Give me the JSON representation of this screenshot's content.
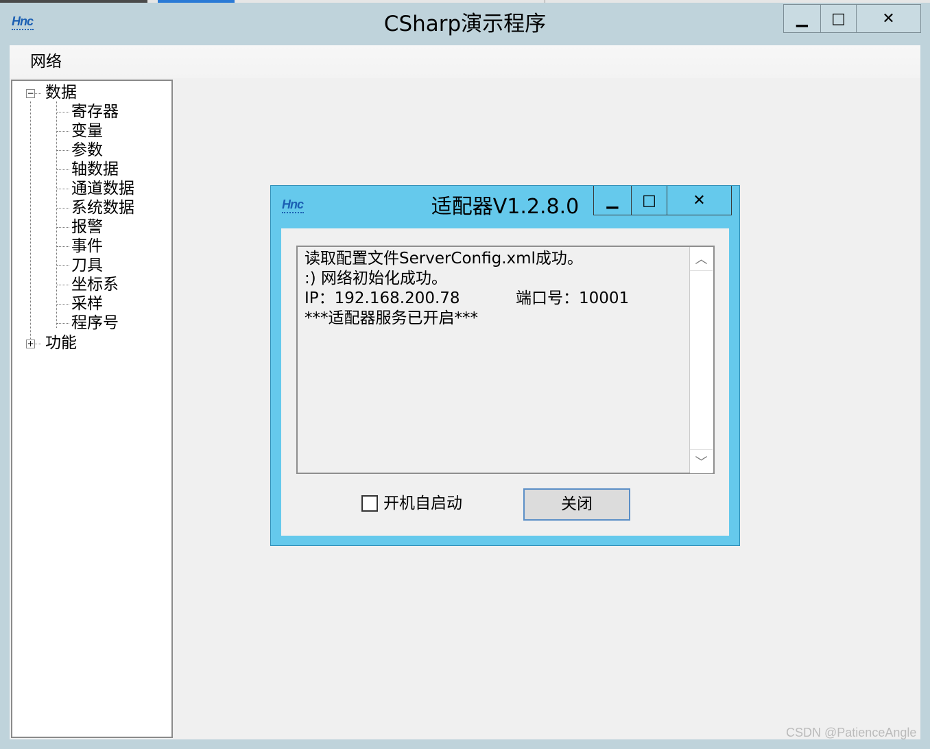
{
  "main_window": {
    "title": "CSharp演示程序",
    "buttons": {
      "minimize": "▁",
      "maximize": "□",
      "close": "✕"
    }
  },
  "menu": {
    "items": [
      "网络"
    ]
  },
  "tree": {
    "root": {
      "label": "数据",
      "expander": "−"
    },
    "children": [
      "寄存器",
      "变量",
      "参数",
      "轴数据",
      "通道数据",
      "系统数据",
      "报警",
      "事件",
      "刀具",
      "坐标系",
      "采样",
      "程序号"
    ],
    "second_root": {
      "label": "功能",
      "expander": "+"
    }
  },
  "dialog": {
    "title": "适配器V1.2.8.0",
    "buttons": {
      "minimize": "▁",
      "maximize": "□",
      "close": "✕"
    },
    "log_lines": [
      "读取配置文件ServerConfig.xml成功。",
      ":) 网络初始化成功。",
      "IP：192.168.200.78",
      "***适配器服务已开启***"
    ],
    "port_text": "端口号：10001",
    "autostart_label": "开机自启动",
    "autostart_checked": false,
    "close_label": "关闭",
    "scroll_up": "︿",
    "scroll_down": "﹀"
  },
  "watermark": "CSDN @PatienceAngle",
  "colors": {
    "dialog_frame": "#65c9ec",
    "window_frame": "#bfd3db",
    "logo": "#1b5fb3"
  }
}
